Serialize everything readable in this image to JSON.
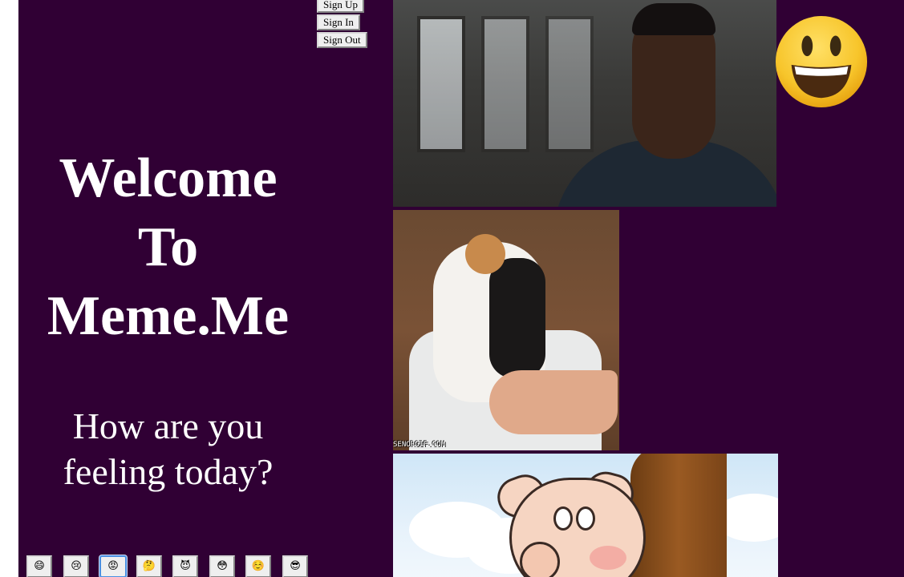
{
  "auth": {
    "sign_up": "Sign Up",
    "sign_in": "Sign In",
    "sign_out": "Sign Out"
  },
  "welcome": {
    "line1": "Welcome",
    "line2": "To",
    "line3": "Meme.Me"
  },
  "question": {
    "line1": "How are you",
    "line2": "feeling today?"
  },
  "moods": [
    {
      "emoji": "😄",
      "name": "grinning",
      "active": false
    },
    {
      "emoji": "😢",
      "name": "crying",
      "active": false
    },
    {
      "emoji": "😡",
      "name": "angry",
      "active": true
    },
    {
      "emoji": "🤔",
      "name": "thinking",
      "active": false
    },
    {
      "emoji": "😈",
      "name": "devil",
      "active": false
    },
    {
      "emoji": "😳",
      "name": "flushed",
      "active": false
    },
    {
      "emoji": "☺️",
      "name": "smiling",
      "active": false
    },
    {
      "emoji": "😎",
      "name": "cool",
      "active": false
    }
  ],
  "gifs": {
    "cat_watermark": "SENORGIF.COM"
  },
  "colors": {
    "background": "#300034",
    "text": "#ffffff",
    "button_bg": "#efefef"
  },
  "current_mood_icon": "smiley-face-icon"
}
